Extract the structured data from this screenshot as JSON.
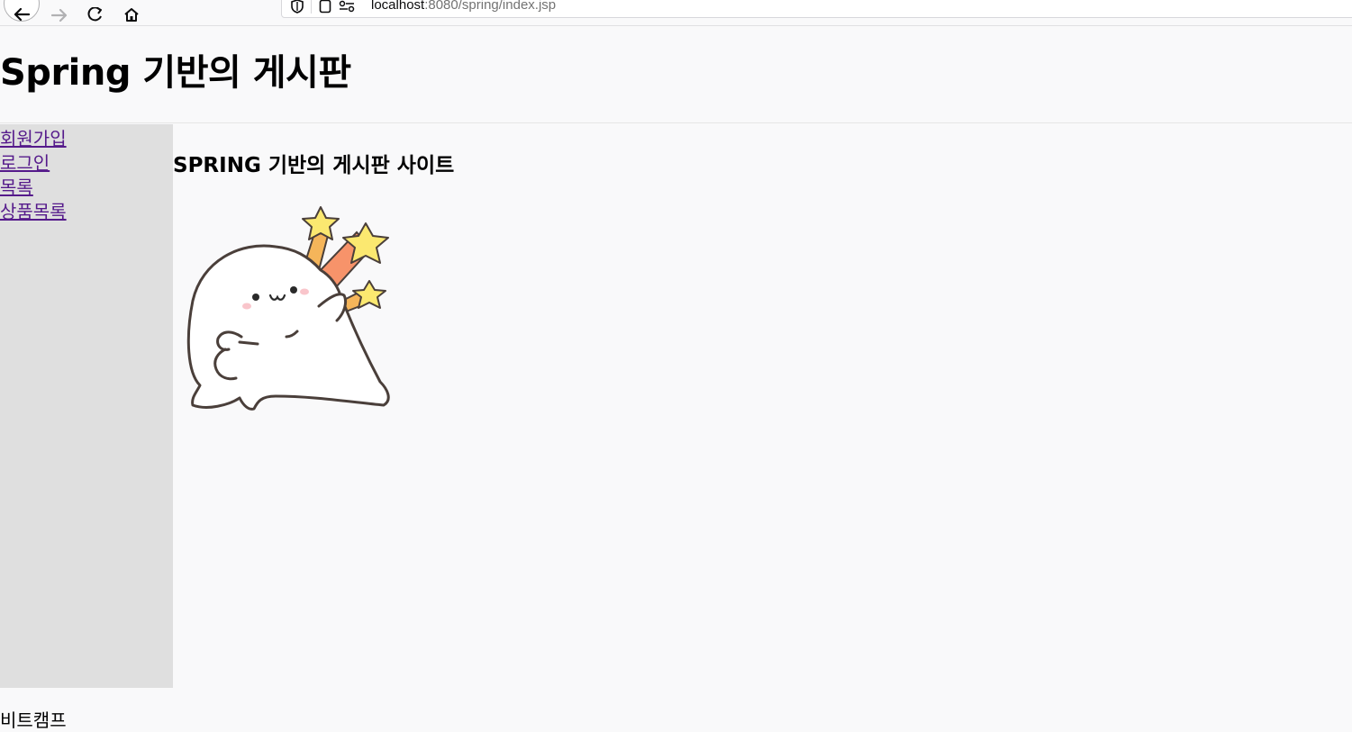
{
  "browser": {
    "url_host": "localhost",
    "url_rest": ":8080/spring/index.jsp"
  },
  "header": {
    "title": "Spring 기반의 게시판"
  },
  "sidebar": {
    "items": [
      {
        "label": "회원가입"
      },
      {
        "label": "로그인"
      },
      {
        "label": "목록"
      },
      {
        "label": "상품목록"
      }
    ]
  },
  "main": {
    "heading": "SPRING 기반의 게시판 사이트"
  },
  "footer": {
    "text": "비트캠프"
  },
  "colors": {
    "sidebar_bg": "#dfdfdf",
    "visited_link": "#551a8b",
    "page_bg": "#f9f9fa"
  }
}
